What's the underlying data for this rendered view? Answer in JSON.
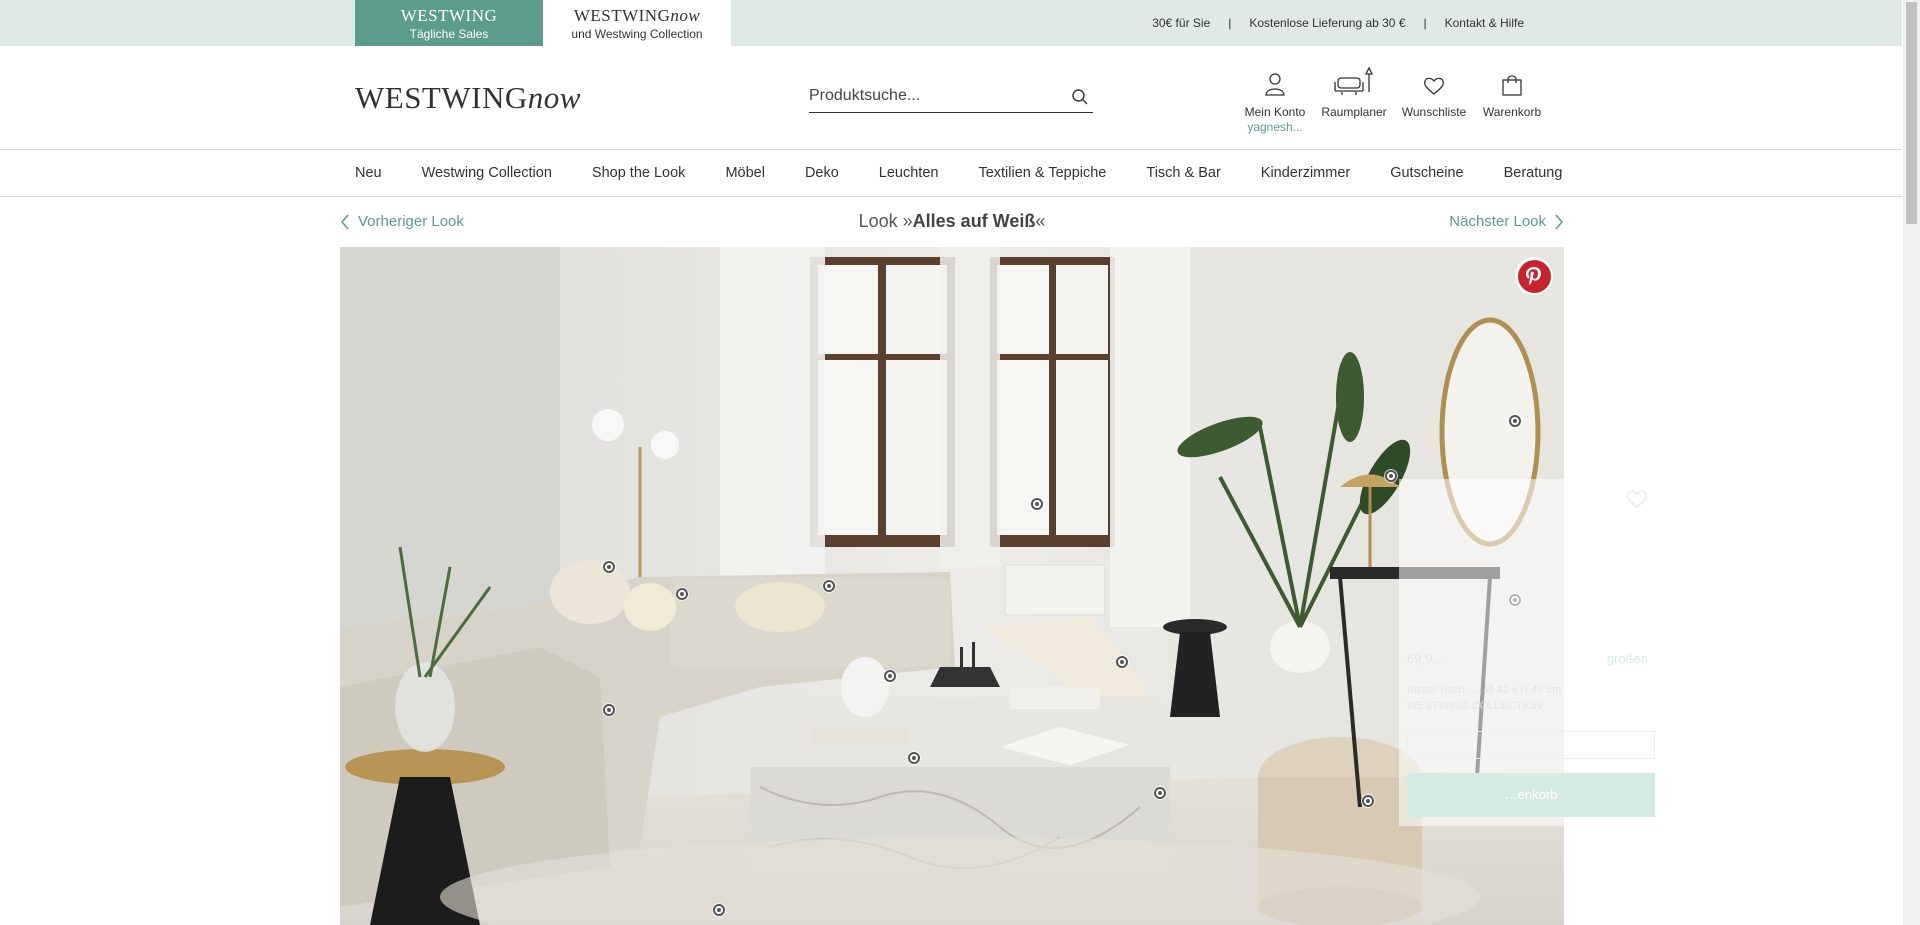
{
  "topbar": {
    "shops": [
      {
        "brand": "WESTWING",
        "sub": "Tägliche Sales"
      },
      {
        "brand": "WESTWING",
        "brand_italic": "now",
        "sub": "und Westwing Collection"
      }
    ],
    "links": [
      "30€ für Sie",
      "Kostenlose Lieferung ab 30 €",
      "Kontakt & Hilfe"
    ]
  },
  "header": {
    "logo": "WESTWING",
    "logo_italic": "now",
    "search_placeholder": "Produktsuche...",
    "icons": [
      {
        "label": "Mein Konto",
        "icon": "user-icon",
        "user": "yagnesh..."
      },
      {
        "label": "Raumplaner",
        "icon": "room-planner-icon"
      },
      {
        "label": "Wunschliste",
        "icon": "heart-icon"
      },
      {
        "label": "Warenkorb",
        "icon": "bag-icon"
      }
    ]
  },
  "nav": [
    "Neu",
    "Westwing Collection",
    "Shop the Look",
    "Möbel",
    "Deko",
    "Leuchten",
    "Textilien & Teppiche",
    "Tisch & Bar",
    "Kinderzimmer",
    "Gutscheine",
    "Beratung"
  ],
  "look": {
    "prev": "Vorheriger Look",
    "next": "Nächster Look",
    "prefix": "Look »",
    "name": "Alles auf Weiß",
    "suffix": "«"
  },
  "tooltip": {
    "price": "69,9…",
    "more": "großen",
    "desc_line1": "Bistro-Tisch …, Ø 42 x H 47 cm",
    "desc_line2": "WESTWING COLLECTION",
    "button": "…enkorb"
  },
  "colors": {
    "accent": "#5b9c8c",
    "pinterest": "#c8232c"
  }
}
